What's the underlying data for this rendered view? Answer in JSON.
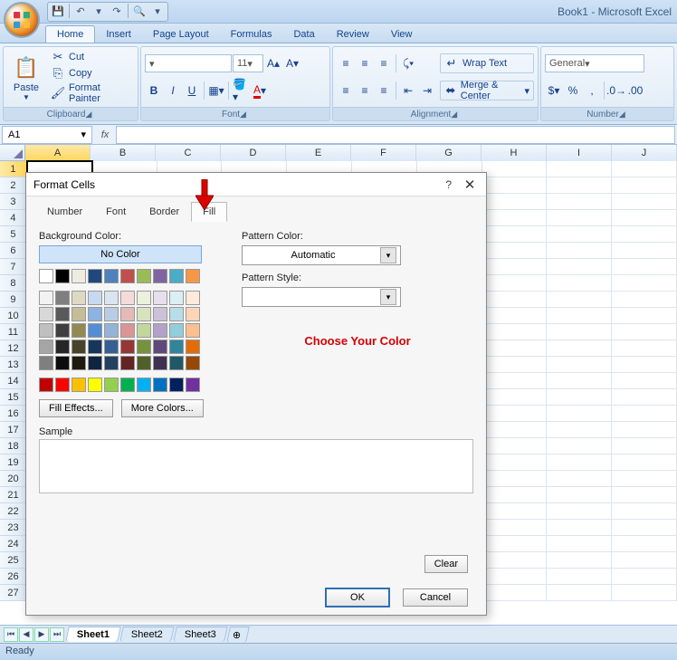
{
  "title": "Book1 - Microsoft Excel",
  "qat": {
    "save": "💾",
    "undo": "↶",
    "redo": "↷",
    "quickprint": "🔍"
  },
  "tabs": [
    "Home",
    "Insert",
    "Page Layout",
    "Formulas",
    "Data",
    "Review",
    "View"
  ],
  "ribbon": {
    "clipboard": {
      "label": "Clipboard",
      "paste": "Paste",
      "cut": "Cut",
      "copy": "Copy",
      "formatpainter": "Format Painter"
    },
    "font": {
      "label": "Font",
      "fontsize": "11",
      "bold": "B",
      "italic": "I",
      "underline": "U"
    },
    "alignment": {
      "label": "Alignment",
      "wrap": "Wrap Text",
      "merge": "Merge & Center"
    },
    "number": {
      "label": "Number",
      "format": "General"
    }
  },
  "namebox": "A1",
  "columns": [
    "A",
    "B",
    "C",
    "D",
    "E",
    "F",
    "G",
    "H",
    "I",
    "J"
  ],
  "rows_count": 27,
  "sheettabs": [
    "Sheet1",
    "Sheet2",
    "Sheet3"
  ],
  "status": "Ready",
  "dialog": {
    "title": "Format Cells",
    "tabs": [
      "Number",
      "Font",
      "Border",
      "Fill"
    ],
    "activeTab": "Fill",
    "bgcolor_label": "Background Color:",
    "nocolor": "No Color",
    "filleffects": "Fill Effects...",
    "morecolors": "More Colors...",
    "patcolor_label": "Pattern Color:",
    "patcolor_value": "Automatic",
    "patstyle_label": "Pattern Style:",
    "sample": "Sample",
    "clear": "Clear",
    "ok": "OK",
    "cancel": "Cancel",
    "annotation": "Choose Your Color",
    "row1": [
      "#ffffff",
      "#000000",
      "#eeece1",
      "#1f497d",
      "#4f81bd",
      "#c0504d",
      "#9bbb59",
      "#8064a2",
      "#4bacc6",
      "#f79646"
    ],
    "theme": [
      [
        "#f2f2f2",
        "#7f7f7f",
        "#ddd9c3",
        "#c6d9f0",
        "#dbe5f1",
        "#f2dcdb",
        "#ebf1dd",
        "#e5e0ec",
        "#dbeef3",
        "#fdeada"
      ],
      [
        "#d8d8d8",
        "#595959",
        "#c4bd97",
        "#8db3e2",
        "#b8cce4",
        "#e5b9b7",
        "#d7e3bc",
        "#ccc1d9",
        "#b7dde8",
        "#fbd5b5"
      ],
      [
        "#bfbfbf",
        "#3f3f3f",
        "#938953",
        "#548dd4",
        "#95b3d7",
        "#d99694",
        "#c3d69b",
        "#b2a2c7",
        "#92cddc",
        "#fac08f"
      ],
      [
        "#a5a5a5",
        "#262626",
        "#494429",
        "#17365d",
        "#366092",
        "#953734",
        "#76923c",
        "#5f497a",
        "#31859b",
        "#e36c09"
      ],
      [
        "#7f7f7f",
        "#0c0c0c",
        "#1d1b10",
        "#0f243e",
        "#244061",
        "#632423",
        "#4f6128",
        "#3f3151",
        "#205867",
        "#974806"
      ]
    ],
    "standard": [
      "#c00000",
      "#ff0000",
      "#ffc000",
      "#ffff00",
      "#92d050",
      "#00b050",
      "#00b0f0",
      "#0070c0",
      "#002060",
      "#7030a0"
    ]
  }
}
